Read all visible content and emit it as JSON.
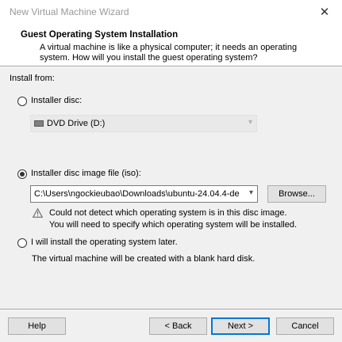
{
  "window": {
    "title": "New Virtual Machine Wizard",
    "close_glyph": "✕"
  },
  "header": {
    "title": "Guest Operating System Installation",
    "description": "A virtual machine is like a physical computer; it needs an operating system. How will you install the guest operating system?"
  },
  "install_from": {
    "label": "Install from:",
    "installer_disc": {
      "label": "Installer disc:",
      "selected": false,
      "drive_value": "DVD Drive (D:)",
      "enabled": false
    },
    "iso": {
      "label": "Installer disc image file (iso):",
      "selected": true,
      "path_value": "C:\\Users\\ngockieubao\\Downloads\\ubuntu-24.04.4-de",
      "browse_label": "Browse...",
      "warning_line1": "Could not detect which operating system is in this disc image.",
      "warning_line2": "You will need to specify which operating system will be installed."
    },
    "later": {
      "label": "I will install the operating system later.",
      "selected": false,
      "note": "The virtual machine will be created with a blank hard disk."
    }
  },
  "footer": {
    "help_label": "Help",
    "back_label": "< Back",
    "next_label": "Next >",
    "cancel_label": "Cancel"
  },
  "colors": {
    "accent": "#0078d7",
    "dialog_bg": "#f0f0f0",
    "warning_icon": "#6b6b6b"
  }
}
